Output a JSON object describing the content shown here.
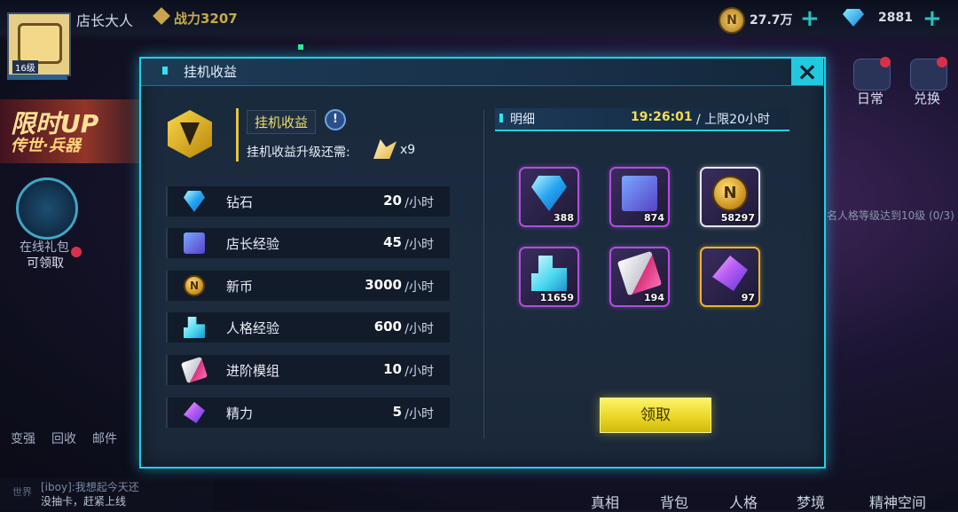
{
  "hud": {
    "player_name": "店长大人",
    "level": "16级",
    "power": "战力3207",
    "coins": "27.7万",
    "gems": "2881",
    "plus": "+"
  },
  "background": {
    "banner_line1": "限时UP",
    "banner_line2": "传世·兵器",
    "online_gift": "在线礼包",
    "claimable": "可领取",
    "left_buttons": [
      "变强",
      "回收",
      "邮件"
    ],
    "chat_channel": "世界",
    "chat_line1": "[iboy]:我想起今天还",
    "chat_line2": "没抽卡，赶紧上线",
    "bottom_nav": [
      "真相",
      "背包",
      "人格",
      "梦境",
      "精神空间"
    ],
    "right_menu": [
      "日常",
      "兑换"
    ],
    "task_text": "名人格等级达到10级 (0/3)"
  },
  "dialog": {
    "title": "挂机收益",
    "close_icon": "close-icon",
    "income_title": "挂机收益",
    "info": "!",
    "upgrade_label": "挂机收益升级还需:",
    "upgrade_count": "x9",
    "rates": [
      {
        "name": "钻石",
        "value": "20",
        "unit": "/小时",
        "icon": "diamond-icon"
      },
      {
        "name": "店长经验",
        "value": "45",
        "unit": "/小时",
        "icon": "exp-book-icon"
      },
      {
        "name": "新币",
        "value": "3000",
        "unit": "/小时",
        "icon": "coin-icon"
      },
      {
        "name": "人格经验",
        "value": "600",
        "unit": "/小时",
        "icon": "cubes-icon"
      },
      {
        "name": "进阶模组",
        "value": "10",
        "unit": "/小时",
        "icon": "module-card-icon"
      },
      {
        "name": "精力",
        "value": "5",
        "unit": "/小时",
        "icon": "energy-crystal-icon"
      }
    ],
    "detail_label": "明细",
    "timer": "19:26:01",
    "limit": "/ 上限20小时",
    "coin_glyph": "N",
    "items": [
      {
        "count": "388",
        "icon": "diamond-icon"
      },
      {
        "count": "874",
        "icon": "exp-book-icon"
      },
      {
        "count": "58297",
        "icon": "coin-icon"
      },
      {
        "count": "11659",
        "icon": "cubes-icon"
      },
      {
        "count": "194",
        "icon": "module-card-icon"
      },
      {
        "count": "97",
        "icon": "energy-crystal-icon"
      }
    ],
    "claim_label": "领取"
  }
}
